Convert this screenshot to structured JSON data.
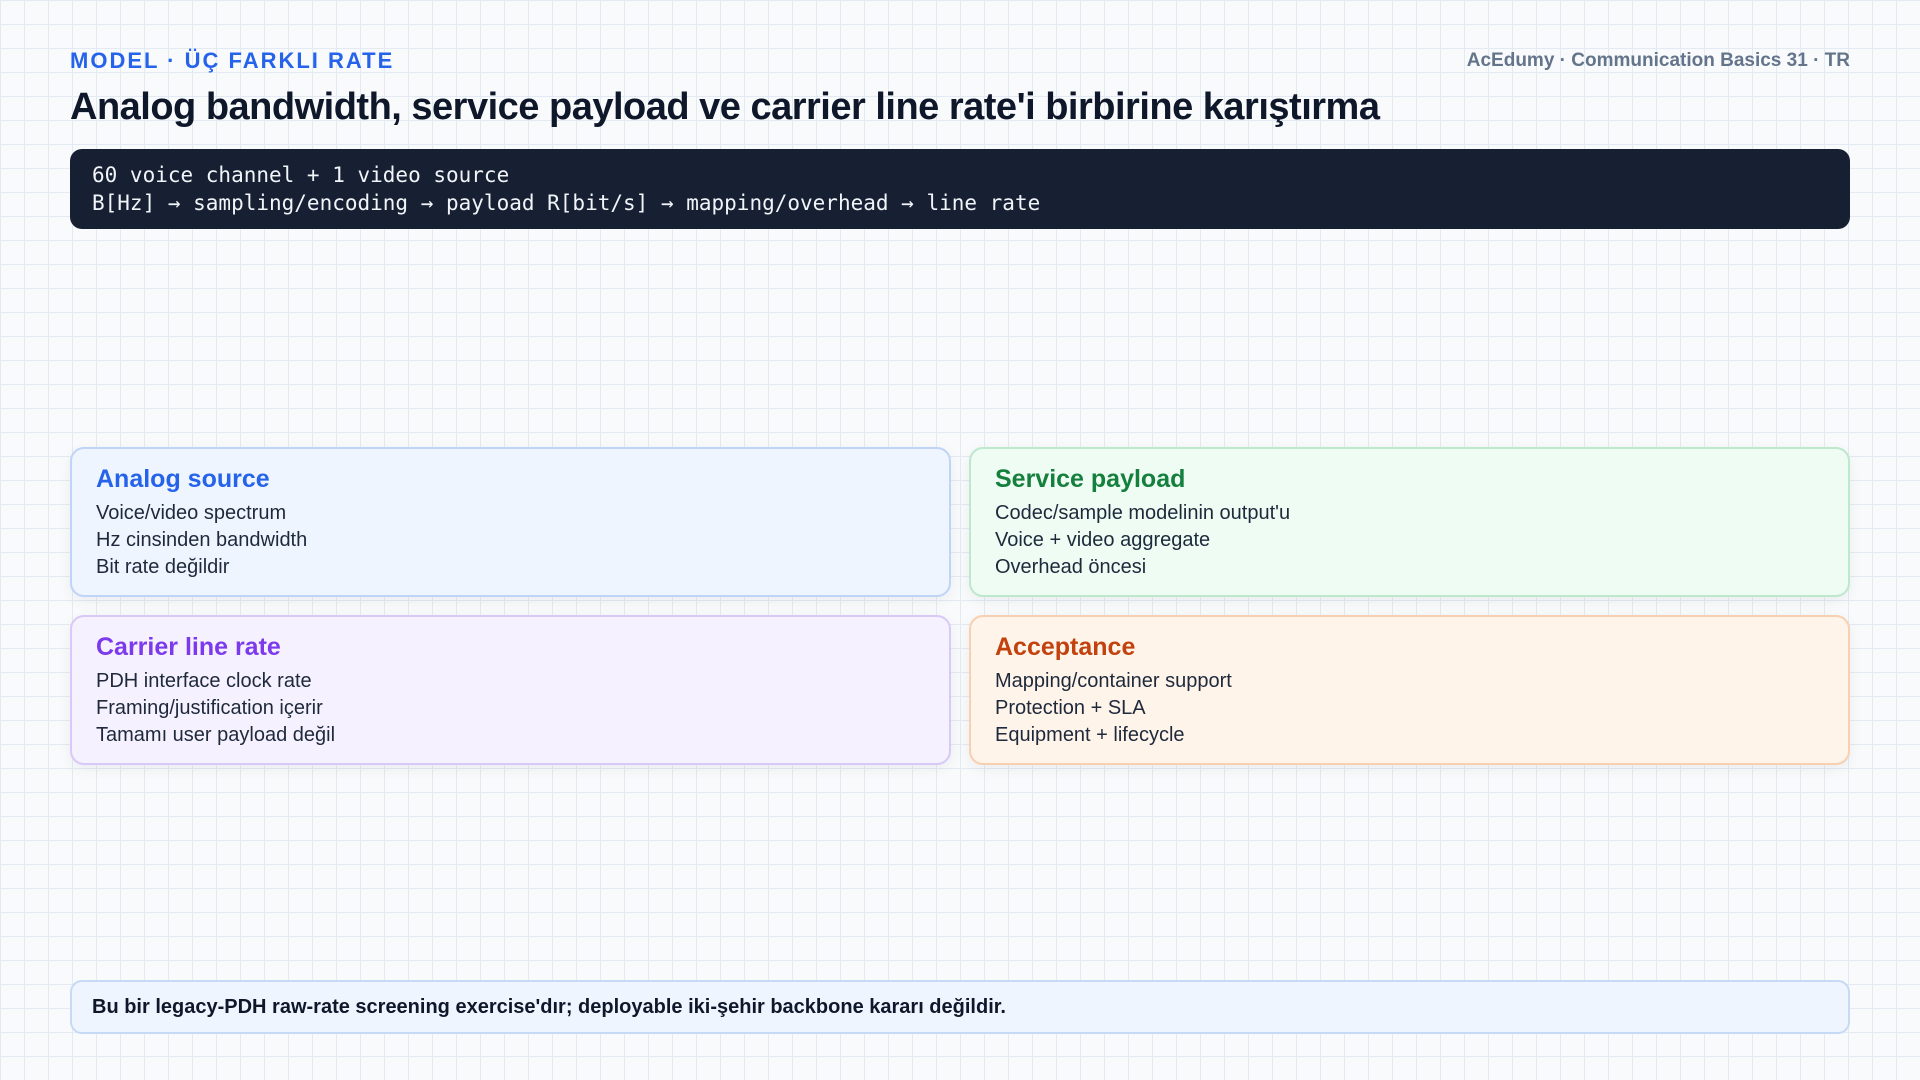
{
  "header": {
    "kicker": "MODEL · ÜÇ FARKLI RATE",
    "brand": "AcEdumy · Communication Basics 31 · TR",
    "title": "Analog bandwidth, service payload ve carrier line rate'i birbirine karıştırma"
  },
  "code": {
    "line1": "60 voice channel + 1 video source",
    "line2": "B[Hz] → sampling/encoding → payload R[bit/s] → mapping/overhead → line rate"
  },
  "cards": [
    {
      "title": "Analog source",
      "lines": [
        "Voice/video spectrum",
        "Hz cinsinden bandwidth",
        "Bit rate değildir"
      ],
      "accent": "#2563eb"
    },
    {
      "title": "Service payload",
      "lines": [
        "Codec/sample modelinin output'u",
        "Voice + video aggregate",
        "Overhead öncesi"
      ],
      "accent": "#15803d"
    },
    {
      "title": "Carrier line rate",
      "lines": [
        "PDH interface clock rate",
        "Framing/justification içerir",
        "Tamamı user payload değil"
      ],
      "accent": "#7c3aed"
    },
    {
      "title": "Acceptance",
      "lines": [
        "Mapping/container support",
        "Protection + SLA",
        "Equipment + lifecycle"
      ],
      "accent": "#c2410c"
    }
  ],
  "footer": {
    "note": "Bu bir legacy-PDH raw-rate screening exercise'dır; deployable iki-şehir backbone kararı değildir."
  }
}
